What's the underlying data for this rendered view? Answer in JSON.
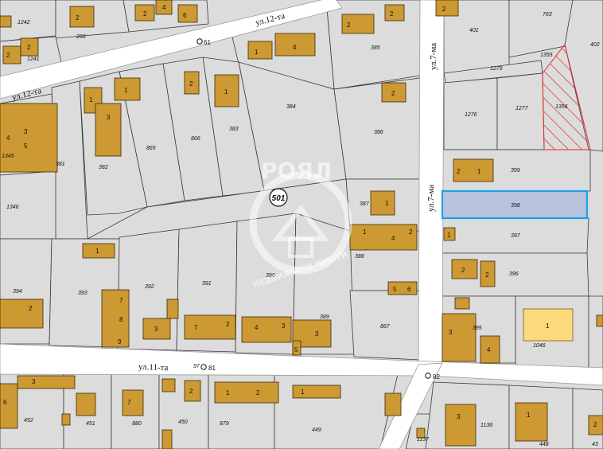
{
  "streets": {
    "s12a": "ул.12-та",
    "s12b": "ул.12-та",
    "s7a": "ул.7-ма",
    "s7b": "ул.7-ма",
    "s11": "ул.11-та"
  },
  "points": {
    "p61": "61",
    "p81": "81",
    "p82": "82",
    "p501": "501",
    "p97": "97"
  },
  "watermark": {
    "brand": "РОЯЛ",
    "sub": "НЕДВИЖИМИ ИМОТИ"
  },
  "parcels": {
    "n1242": "1242",
    "n266": "266",
    "n385": "385",
    "n401": "401",
    "n763": "763",
    "n402": "402",
    "n1241": "1241",
    "n1355": "1355",
    "n1279": "1279",
    "n384": "384",
    "n383": "383",
    "n386": "386",
    "n1276": "1276",
    "n1277": "1277",
    "n1356": "1356",
    "n865": "865",
    "n866": "866",
    "n382": "382",
    "n381": "381",
    "n1345": "1345",
    "n1346": "1346",
    "n399": "399",
    "n398": "398",
    "n397": "397",
    "n387": "387",
    "n388": "388",
    "n396": "396",
    "n394": "394",
    "n393": "393",
    "n392": "392",
    "n391": "391",
    "n390": "390",
    "n389": "389",
    "n867": "867",
    "n395": "395",
    "n1046": "1046",
    "n452": "452",
    "n451": "451",
    "n880": "880",
    "n450": "450",
    "n879": "879",
    "n449": "449",
    "n1137": "1137",
    "n1138": "1138",
    "n448": "448",
    "n43": "43"
  },
  "buildings": {
    "b1": "1",
    "b2": "2",
    "b3": "3",
    "b4": "4",
    "b5": "5",
    "b6": "6",
    "b7": "7",
    "b8": "8",
    "b9": "9"
  },
  "colors": {
    "highlight_fill": "#b8c2dc",
    "highlight_stroke": "#1aa3e8",
    "hatch": "#e3262a",
    "building": "#cc9933",
    "building_selected": "#fcd97a"
  }
}
